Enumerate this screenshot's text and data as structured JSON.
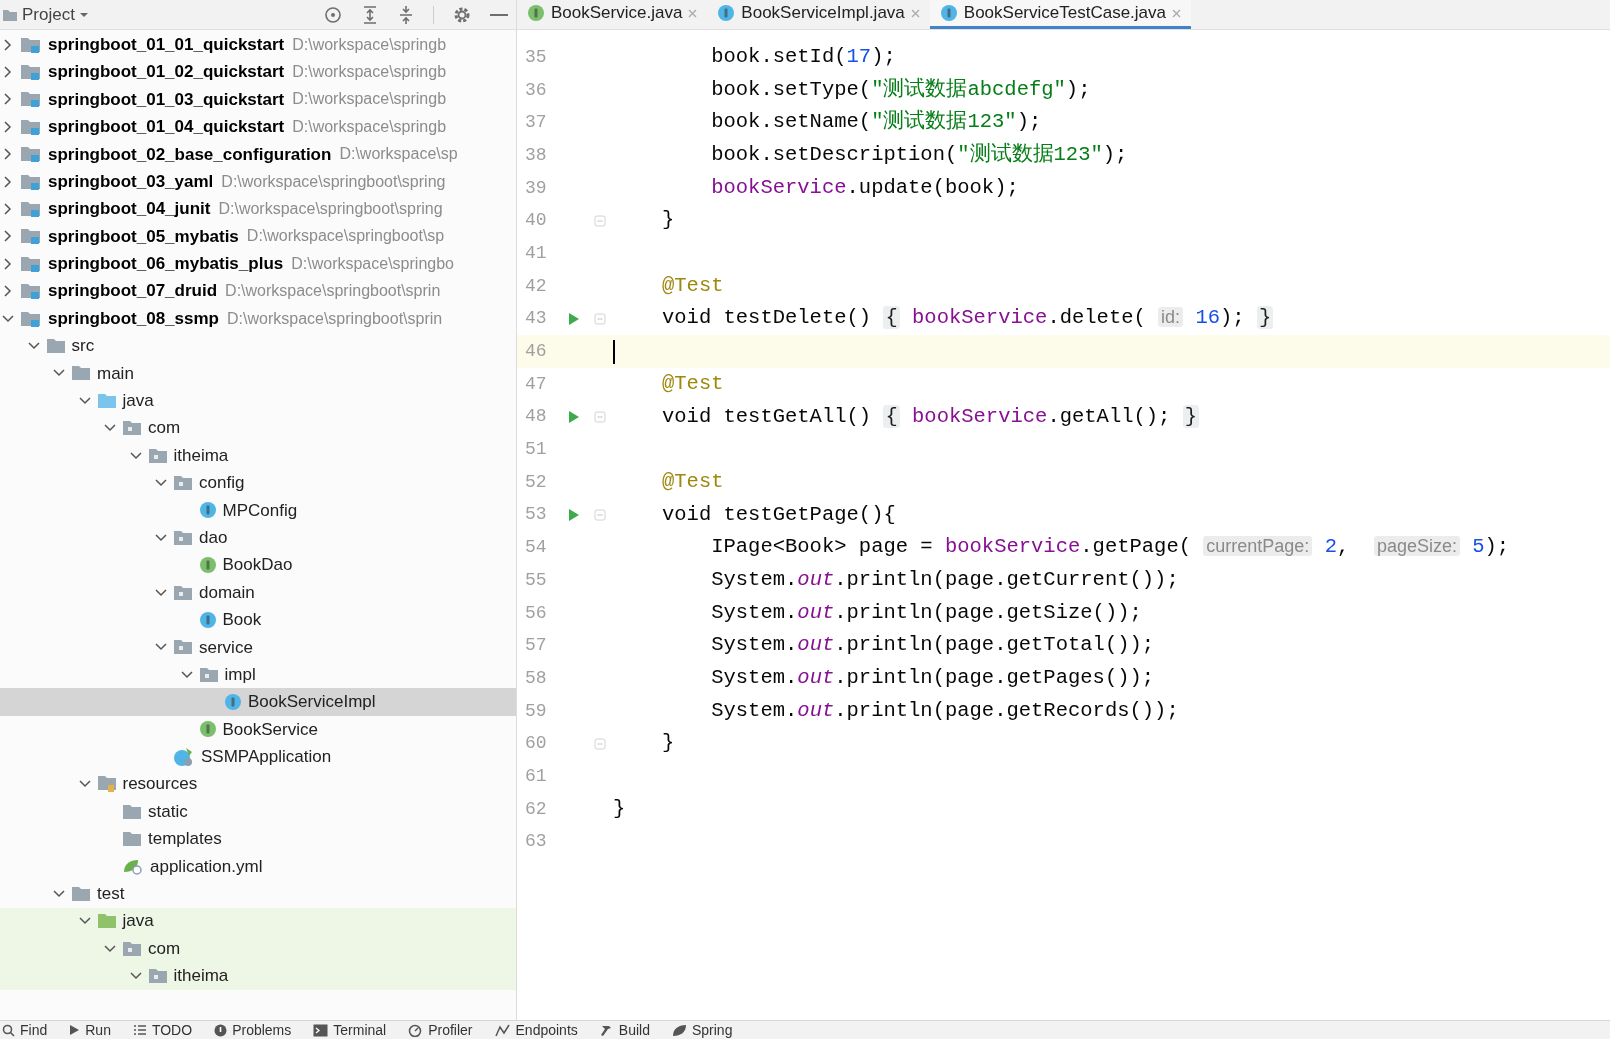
{
  "project_panel": {
    "title": "Project",
    "tree": [
      {
        "kind": "module",
        "label": "springboot_01_01_quickstart",
        "path": "D:\\workspace\\springb",
        "expanded": false,
        "selected": false
      },
      {
        "kind": "module",
        "label": "springboot_01_02_quickstart",
        "path": "D:\\workspace\\springb",
        "expanded": false,
        "selected": false
      },
      {
        "kind": "module",
        "label": "springboot_01_03_quickstart",
        "path": "D:\\workspace\\springb",
        "expanded": false,
        "selected": false
      },
      {
        "kind": "module",
        "label": "springboot_01_04_quickstart",
        "path": "D:\\workspace\\springb",
        "expanded": false,
        "selected": false
      },
      {
        "kind": "module",
        "label": "springboot_02_base_configuration",
        "path": "D:\\workspace\\sp",
        "expanded": false,
        "selected": false
      },
      {
        "kind": "module",
        "label": "springboot_03_yaml",
        "path": "D:\\workspace\\springboot\\spring",
        "expanded": false,
        "selected": false
      },
      {
        "kind": "module",
        "label": "springboot_04_junit",
        "path": "D:\\workspace\\springboot\\spring",
        "expanded": false,
        "selected": false
      },
      {
        "kind": "module",
        "label": "springboot_05_mybatis",
        "path": "D:\\workspace\\springboot\\sp",
        "expanded": false,
        "selected": false
      },
      {
        "kind": "module",
        "label": "springboot_06_mybatis_plus",
        "path": "D:\\workspace\\springbo",
        "expanded": false,
        "selected": false
      },
      {
        "kind": "module",
        "label": "springboot_07_druid",
        "path": "D:\\workspace\\springboot\\sprin",
        "expanded": false,
        "selected": false
      },
      {
        "kind": "module",
        "label": "springboot_08_ssmp",
        "path": "D:\\workspace\\springboot\\sprin",
        "expanded": true,
        "selected": false,
        "children": [
          {
            "kind": "folder",
            "label": "src",
            "expanded": true,
            "selected": false,
            "children": [
              {
                "kind": "folder",
                "label": "main",
                "expanded": true,
                "selected": false,
                "children": [
                  {
                    "kind": "source_folder",
                    "label": "java",
                    "expanded": true,
                    "selected": false,
                    "children": [
                      {
                        "kind": "package",
                        "label": "com",
                        "expanded": true,
                        "selected": false,
                        "children": [
                          {
                            "kind": "package",
                            "label": "itheima",
                            "expanded": true,
                            "selected": false,
                            "children": [
                              {
                                "kind": "package",
                                "label": "config",
                                "expanded": true,
                                "selected": false,
                                "children": [
                                  {
                                    "kind": "class",
                                    "label": "MPConfig",
                                    "selected": false
                                  }
                                ]
                              },
                              {
                                "kind": "package",
                                "label": "dao",
                                "expanded": true,
                                "selected": false,
                                "children": [
                                  {
                                    "kind": "interface",
                                    "label": "BookDao",
                                    "selected": false
                                  }
                                ]
                              },
                              {
                                "kind": "package",
                                "label": "domain",
                                "expanded": true,
                                "selected": false,
                                "children": [
                                  {
                                    "kind": "class",
                                    "label": "Book",
                                    "selected": false
                                  }
                                ]
                              },
                              {
                                "kind": "package",
                                "label": "service",
                                "expanded": true,
                                "selected": false,
                                "children": [
                                  {
                                    "kind": "package",
                                    "label": "impl",
                                    "expanded": true,
                                    "selected": false,
                                    "children": [
                                      {
                                        "kind": "class",
                                        "label": "BookServiceImpl",
                                        "selected": true
                                      }
                                    ]
                                  },
                                  {
                                    "kind": "interface",
                                    "label": "BookService",
                                    "selected": false
                                  }
                                ]
                              },
                              {
                                "kind": "app_class",
                                "label": "SSMPApplication",
                                "selected": false
                              }
                            ]
                          }
                        ]
                      }
                    ]
                  },
                  {
                    "kind": "resources_folder",
                    "label": "resources",
                    "expanded": true,
                    "selected": false,
                    "children": [
                      {
                        "kind": "folder",
                        "label": "static",
                        "selected": false
                      },
                      {
                        "kind": "folder",
                        "label": "templates",
                        "selected": false
                      },
                      {
                        "kind": "yaml",
                        "label": "application.yml",
                        "selected": false
                      }
                    ]
                  }
                ]
              },
              {
                "kind": "folder",
                "label": "test",
                "expanded": true,
                "selected": false,
                "children": [
                  {
                    "kind": "test_source_folder",
                    "label": "java",
                    "expanded": true,
                    "selected": false,
                    "children": [
                      {
                        "kind": "package",
                        "label": "com",
                        "expanded": true,
                        "selected": false,
                        "children": [
                          {
                            "kind": "package",
                            "label": "itheima",
                            "expanded": true,
                            "selected": false
                          }
                        ]
                      }
                    ]
                  }
                ]
              }
            ]
          }
        ]
      }
    ]
  },
  "editor_tabs": [
    {
      "kind": "interface",
      "label": "BookService.java",
      "selected": false
    },
    {
      "kind": "class",
      "label": "BookServiceImpl.java",
      "selected": false
    },
    {
      "kind": "test_class",
      "label": "BookServiceTestCase.java",
      "selected": true
    }
  ],
  "code": {
    "lines": [
      {
        "number": "35",
        "tokens": [
          {
            "kind": "plain",
            "text": "    book.setId("
          },
          {
            "kind": "number",
            "text": "17"
          },
          {
            "kind": "plain",
            "text": ");"
          }
        ]
      },
      {
        "number": "36",
        "tokens": [
          {
            "kind": "plain",
            "text": "    book.setType("
          },
          {
            "kind": "string",
            "text": "\"测试数据abcdefg\""
          },
          {
            "kind": "plain",
            "text": ");"
          }
        ]
      },
      {
        "number": "37",
        "tokens": [
          {
            "kind": "plain",
            "text": "    book.setName("
          },
          {
            "kind": "string",
            "text": "\"测试数据123\""
          },
          {
            "kind": "plain",
            "text": ");"
          }
        ]
      },
      {
        "number": "38",
        "tokens": [
          {
            "kind": "plain",
            "text": "    book.setDescription("
          },
          {
            "kind": "string",
            "text": "\"测试数据123\""
          },
          {
            "kind": "plain",
            "text": ");"
          }
        ]
      },
      {
        "number": "39",
        "tokens": [
          {
            "kind": "field",
            "text": "    bookService"
          },
          {
            "kind": "plain",
            "text": ".update(book);"
          }
        ]
      },
      {
        "number": "40",
        "fold": true,
        "tokens": [
          {
            "kind": "plain",
            "text": "}"
          }
        ]
      },
      {
        "number": "41"
      },
      {
        "number": "42",
        "tokens": [
          {
            "kind": "annotation",
            "text": "@Test"
          }
        ]
      },
      {
        "number": "43",
        "run": true,
        "fold": true,
        "tokens": [
          {
            "kind": "plain",
            "text": "void testDelete() "
          },
          {
            "kind": "folded",
            "text": "{"
          },
          {
            "kind": "field",
            "text": " bookService"
          },
          {
            "kind": "plain",
            "text": ".delete( "
          },
          {
            "kind": "hint",
            "text": "id:"
          },
          {
            "kind": "number",
            "text": " 16"
          },
          {
            "kind": "plain",
            "text": "); "
          },
          {
            "kind": "folded",
            "text": "}"
          }
        ]
      },
      {
        "number": "46",
        "current": true
      },
      {
        "number": "47",
        "tokens": [
          {
            "kind": "annotation",
            "text": "@Test"
          }
        ]
      },
      {
        "number": "48",
        "run": true,
        "fold": true,
        "tokens": [
          {
            "kind": "plain",
            "text": "void testGetAll() "
          },
          {
            "kind": "folded",
            "text": "{"
          },
          {
            "kind": "field",
            "text": " bookService"
          },
          {
            "kind": "plain",
            "text": ".getAll(); "
          },
          {
            "kind": "folded",
            "text": "}"
          }
        ]
      },
      {
        "number": "51"
      },
      {
        "number": "52",
        "tokens": [
          {
            "kind": "annotation",
            "text": "@Test"
          }
        ]
      },
      {
        "number": "53",
        "run": true,
        "fold": true,
        "tokens": [
          {
            "kind": "plain",
            "text": "void testGetPage(){"
          }
        ]
      },
      {
        "number": "54",
        "tokens": [
          {
            "kind": "plain",
            "text": "    IPage<Book> page = "
          },
          {
            "kind": "field",
            "text": "bookService"
          },
          {
            "kind": "plain",
            "text": ".getPage( "
          },
          {
            "kind": "hint",
            "text": "currentPage:"
          },
          {
            "kind": "number",
            "text": " 2"
          },
          {
            "kind": "plain",
            "text": ",  "
          },
          {
            "kind": "hint",
            "text": "pageSize:"
          },
          {
            "kind": "number",
            "text": " 5"
          },
          {
            "kind": "plain",
            "text": ");"
          }
        ]
      },
      {
        "number": "55",
        "tokens": [
          {
            "kind": "plain",
            "text": "    System."
          },
          {
            "kind": "static_field",
            "text": "out"
          },
          {
            "kind": "plain",
            "text": ".println(page.getCurrent());"
          }
        ]
      },
      {
        "number": "56",
        "tokens": [
          {
            "kind": "plain",
            "text": "    System."
          },
          {
            "kind": "static_field",
            "text": "out"
          },
          {
            "kind": "plain",
            "text": ".println(page.getSize());"
          }
        ]
      },
      {
        "number": "57",
        "tokens": [
          {
            "kind": "plain",
            "text": "    System."
          },
          {
            "kind": "static_field",
            "text": "out"
          },
          {
            "kind": "plain",
            "text": ".println(page.getTotal());"
          }
        ]
      },
      {
        "number": "58",
        "tokens": [
          {
            "kind": "plain",
            "text": "    System."
          },
          {
            "kind": "static_field",
            "text": "out"
          },
          {
            "kind": "plain",
            "text": ".println(page.getPages());"
          }
        ]
      },
      {
        "number": "59",
        "tokens": [
          {
            "kind": "plain",
            "text": "    System."
          },
          {
            "kind": "static_field",
            "text": "out"
          },
          {
            "kind": "plain",
            "text": ".println(page.getRecords());"
          }
        ]
      },
      {
        "number": "60",
        "fold": true,
        "tokens": [
          {
            "kind": "plain",
            "text": "}"
          }
        ]
      },
      {
        "number": "61"
      },
      {
        "number": "62",
        "outer": true,
        "tokens": [
          {
            "kind": "plain",
            "text": "}"
          }
        ]
      },
      {
        "number": "63"
      }
    ]
  },
  "tool_windows": [
    {
      "kind": "find",
      "label": "Find"
    },
    {
      "kind": "run",
      "label": "Run"
    },
    {
      "kind": "todo",
      "label": "TODO"
    },
    {
      "kind": "problems",
      "label": "Problems"
    },
    {
      "kind": "terminal",
      "label": "Terminal"
    },
    {
      "kind": "profiler",
      "label": "Profiler"
    },
    {
      "kind": "endpoints",
      "label": "Endpoints"
    },
    {
      "kind": "build",
      "label": "Build"
    },
    {
      "kind": "spring",
      "label": "Spring"
    }
  ]
}
